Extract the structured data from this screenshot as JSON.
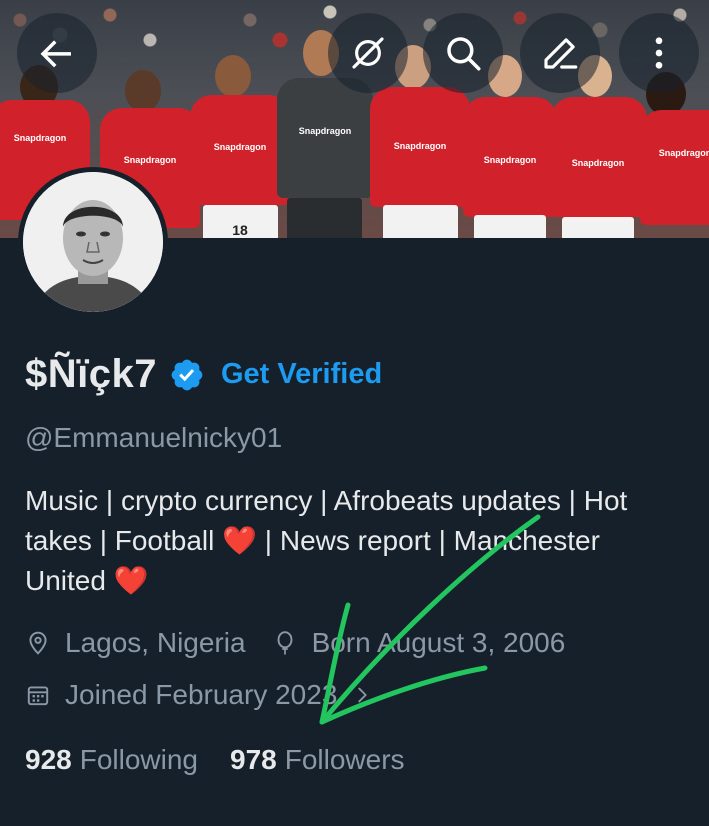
{
  "header": {
    "back_icon": "arrow-left-icon",
    "actions": [
      "hide-icon",
      "search-icon",
      "edit-icon",
      "more-vertical-icon"
    ],
    "banner_sponsor": "Snapdragon",
    "banner_number": "18"
  },
  "profile": {
    "display_name": "$Ñïçk7",
    "verified_badge_color": "#1d9bf0",
    "get_verified_label": "Get Verified",
    "handle": "@Emmanuelnicky01",
    "bio_line1": "Music | crypto currency | Afrobeats updates | Hot",
    "bio_line2_a": "takes | Football ",
    "bio_line2_b": " | News report | Manchester",
    "bio_line3": "United ",
    "heart": "❤️",
    "location": "Lagos, Nigeria",
    "born": "Born August 3, 2006",
    "joined": "Joined February 2023"
  },
  "stats": {
    "following_count": "928",
    "following_label": "Following",
    "followers_count": "978",
    "followers_label": "Followers"
  },
  "colors": {
    "background": "#15202b",
    "accent": "#1d9bf0",
    "muted": "#8b98a5",
    "annotation_arrow": "#22c55e"
  }
}
